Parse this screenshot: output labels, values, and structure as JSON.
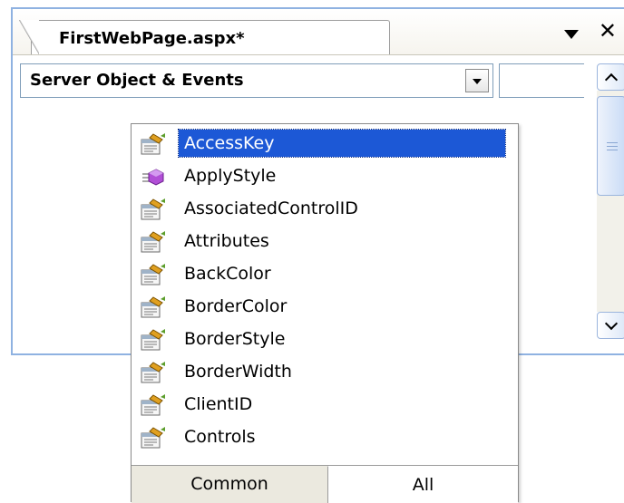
{
  "editor": {
    "tab_title": "FirstWebPage.aspx*",
    "object_dropdown": "Server Object & Events",
    "event_dropdown": ""
  },
  "completion": {
    "items": [
      {
        "label": "AccessKey",
        "icon": "property-icon",
        "selected": true
      },
      {
        "label": "ApplyStyle",
        "icon": "method-icon",
        "selected": false
      },
      {
        "label": "AssociatedControlID",
        "icon": "property-icon",
        "selected": false
      },
      {
        "label": "Attributes",
        "icon": "property-icon",
        "selected": false
      },
      {
        "label": "BackColor",
        "icon": "property-icon",
        "selected": false
      },
      {
        "label": "BorderColor",
        "icon": "property-icon",
        "selected": false
      },
      {
        "label": "BorderStyle",
        "icon": "property-icon",
        "selected": false
      },
      {
        "label": "BorderWidth",
        "icon": "property-icon",
        "selected": false
      },
      {
        "label": "ClientID",
        "icon": "property-icon",
        "selected": false
      },
      {
        "label": "Controls",
        "icon": "property-icon",
        "selected": false
      }
    ],
    "tabs": [
      {
        "label": "Common",
        "active": false
      },
      {
        "label": "All",
        "active": true
      }
    ]
  },
  "colors": {
    "selection": "#1c58d6",
    "window_border": "#8fb2e1"
  }
}
